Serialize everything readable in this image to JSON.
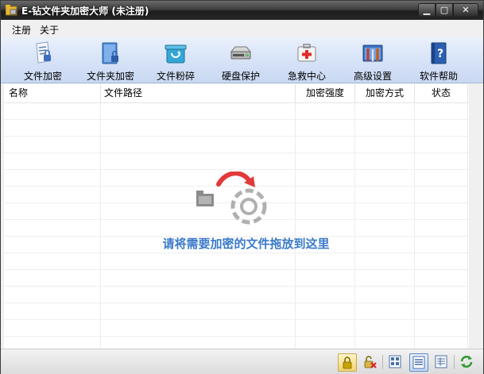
{
  "window": {
    "title": "E-钻文件夹加密大师 (未注册)"
  },
  "menu": [
    {
      "label": "注册"
    },
    {
      "label": "关于"
    }
  ],
  "toolbar": [
    {
      "label": "文件加密",
      "icon": "lock-document-icon"
    },
    {
      "label": "文件夹加密",
      "icon": "lock-folder-icon"
    },
    {
      "label": "文件粉碎",
      "icon": "shredder-icon"
    },
    {
      "label": "硬盘保护",
      "icon": "harddisk-icon"
    },
    {
      "label": "急救中心",
      "icon": "first-aid-kit-icon"
    },
    {
      "label": "高级设置",
      "icon": "settings-tools-icon"
    },
    {
      "label": "软件帮助",
      "icon": "help-book-icon"
    }
  ],
  "table": {
    "columns": [
      "名称",
      "文件路径",
      "加密强度",
      "加密方式",
      "状态"
    ]
  },
  "drop_hint": "请将需要加密的文件拖放到这里",
  "colors": {
    "hint": "#3a7ac8",
    "toolbar": "#d7e3f7",
    "titlebar": "#2c2c2c"
  }
}
